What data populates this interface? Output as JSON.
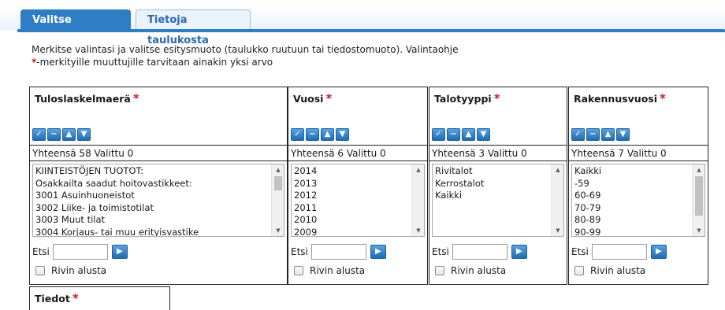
{
  "tabs": [
    {
      "label": "Valitse muuttujat",
      "active": true
    },
    {
      "label": "Tietoja taulukosta",
      "active": false
    }
  ],
  "instructions": {
    "line1": "Merkitse valintasi ja valitse esitysmuoto (taulukko ruutuun tai tiedostomuoto). Valintaohje",
    "required_mark": "*",
    "line2": "-merkityille muuttujille tarvitaan ainakin yksi arvo"
  },
  "colors": {
    "accent": "#2f7ec4",
    "required": "#d0161b"
  },
  "variables": [
    {
      "title": "Tuloslaskelmaerä",
      "required_mark": "*",
      "count_text": "Yhteensä 58 Valittu 0",
      "items": [
        "KIINTEISTÖJEN TUOTOT:",
        "Osakkailta saadut hoitovastikkeet:",
        "3001 Asuinhuoneistot",
        "3002 Liike- ja toimistotilat",
        "3003 Muut tilat",
        "3004 Korjaus- tai muu erityisvastike"
      ],
      "search_label": "Etsi",
      "search_value": "",
      "begin_label": "Rivin alusta"
    },
    {
      "title": "Vuosi",
      "required_mark": "*",
      "count_text": "Yhteensä 6 Valittu 0",
      "items": [
        "2014",
        "2013",
        "2012",
        "2011",
        "2010",
        "2009"
      ],
      "search_label": "Etsi",
      "search_value": "",
      "begin_label": "Rivin alusta"
    },
    {
      "title": "Talotyyppi",
      "required_mark": "*",
      "count_text": "Yhteensä 3 Valittu 0",
      "items": [
        "Rivitalot",
        "Kerrostalot",
        "Kaikki"
      ],
      "search_label": "Etsi",
      "search_value": "",
      "begin_label": "Rivin alusta"
    },
    {
      "title": "Rakennusvuosi",
      "required_mark": "*",
      "count_text": "Yhteensä 7 Valittu 0",
      "items": [
        "Kaikki",
        "-59",
        "60-69",
        "70-79",
        "80-89",
        "90-99"
      ],
      "search_label": "Etsi",
      "search_value": "",
      "begin_label": "Rivin alusta"
    }
  ],
  "tiedot": {
    "title": "Tiedot",
    "required_mark": "*"
  },
  "icons": {
    "select_all": "check-icon",
    "deselect_all": "minus-icon",
    "sort_up": "arrow-up-icon",
    "sort_down": "arrow-down-icon",
    "search_go": "arrow-right-icon"
  }
}
